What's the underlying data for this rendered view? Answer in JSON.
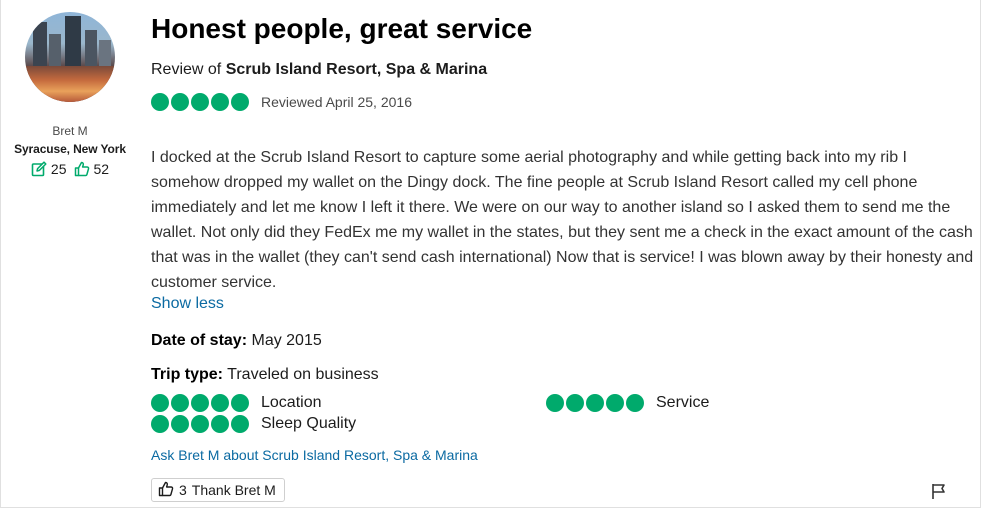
{
  "reviewer": {
    "name": "Bret M",
    "location": "Syracuse, New York",
    "contributions": "25",
    "helpful_votes": "52"
  },
  "review": {
    "title": "Honest people, great service",
    "review_of_prefix": "Review of",
    "property": "Scrub Island Resort, Spa & Marina",
    "rating": 5,
    "reviewed_date": "Reviewed April 25, 2016",
    "body": "I docked at the Scrub Island Resort to capture some aerial photography and while getting back into my rib I somehow dropped my wallet on the Dingy dock. The fine people at Scrub Island Resort called my cell phone immediately and let me know I left it there. We were on our way to another island so I asked them to send me the wallet. Not only did they FedEx me my wallet in the states, but they sent me a check in the exact amount of the cash that was in the wallet (they can't send cash international) Now that is service! I was blown away by their honesty and customer service.",
    "show_less": "Show less",
    "date_of_stay_label": "Date of stay:",
    "date_of_stay": "May 2015",
    "trip_type_label": "Trip type:",
    "trip_type": "Traveled on business",
    "sub_ratings": [
      {
        "label": "Location",
        "rating": 5
      },
      {
        "label": "Service",
        "rating": 5
      },
      {
        "label": "Sleep Quality",
        "rating": 5
      }
    ],
    "ask_link": "Ask Bret M about Scrub Island Resort, Spa & Marina",
    "thank_count": "3",
    "thank_label": "Thank Bret M"
  },
  "colors": {
    "bubble": "#00aa6c",
    "link": "#0b6aa2"
  },
  "icons": [
    "edit-icon",
    "thumbs-up-icon",
    "flag-icon"
  ]
}
